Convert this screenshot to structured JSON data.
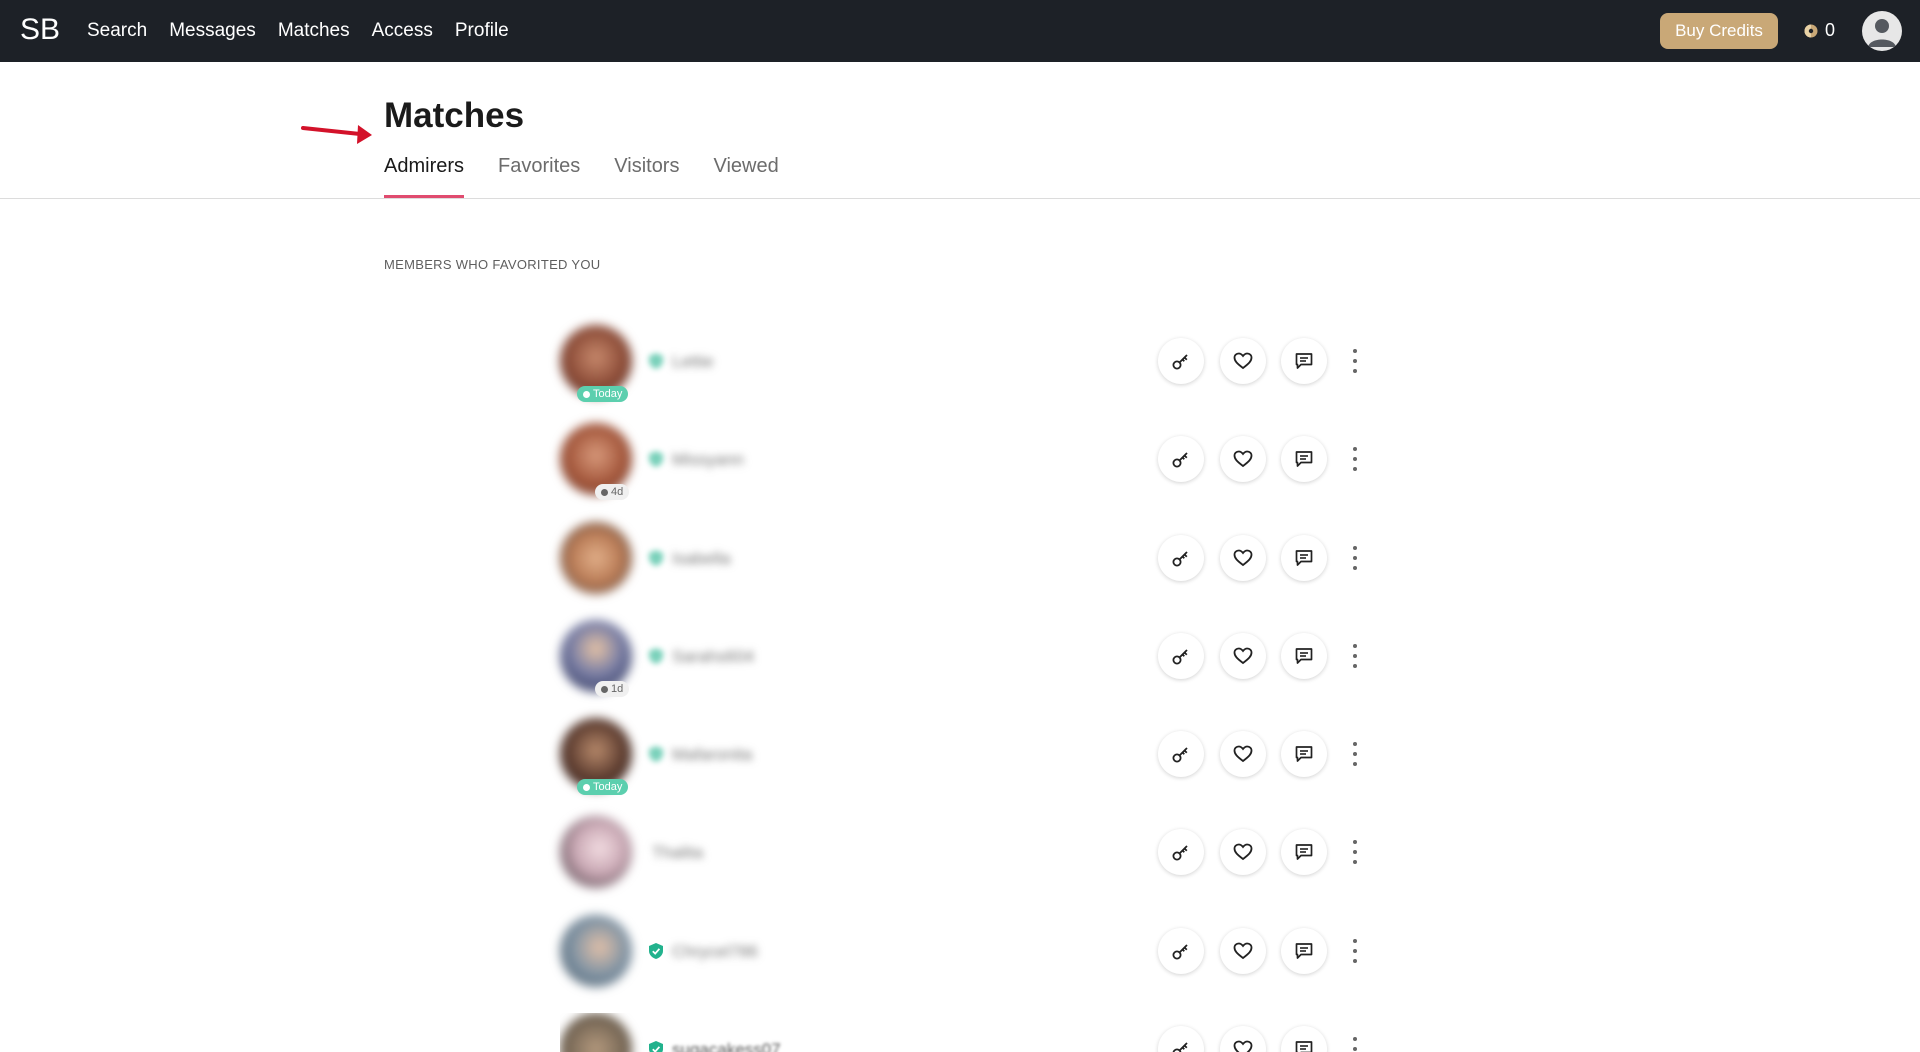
{
  "topbar": {
    "logo": "SB",
    "nav": [
      "Search",
      "Messages",
      "Matches",
      "Access",
      "Profile"
    ],
    "buy_credits": "Buy Credits",
    "credits": "0"
  },
  "page": {
    "title": "Matches",
    "tabs": [
      "Admirers",
      "Favorites",
      "Visitors",
      "Viewed"
    ],
    "active_tab": "Admirers",
    "section_label": "MEMBERS WHO FAVORITED YOU"
  },
  "members": [
    {
      "name": "Lettie",
      "status": "Today",
      "verified_icon": "blurred"
    },
    {
      "name": "Missyann",
      "status": "4d",
      "verified_icon": "blurred"
    },
    {
      "name": "Isabella",
      "status": "",
      "verified_icon": "blurred"
    },
    {
      "name": "Sarahs604",
      "status": "1d",
      "verified_icon": "blurred"
    },
    {
      "name": "Mafaronita",
      "status": "Today",
      "verified_icon": "blurred"
    },
    {
      "name": "Thalita",
      "status": "",
      "verified_icon": "none"
    },
    {
      "name": "Chrycel786",
      "status": "",
      "verified_icon": "shield-check"
    },
    {
      "name": "sugacakess07",
      "status": "",
      "verified_icon": "shield-check"
    }
  ],
  "row_actions": [
    "key-icon",
    "heart-icon",
    "message-icon",
    "more-icon"
  ],
  "colors": {
    "topbar": "#1d2127",
    "buy_credits": "#c9a877",
    "active_tab_underline": "#e04b6f",
    "online_pill": "#5ccfae",
    "verified": "#22b28d",
    "annotation_arrow": "#d3122a"
  }
}
